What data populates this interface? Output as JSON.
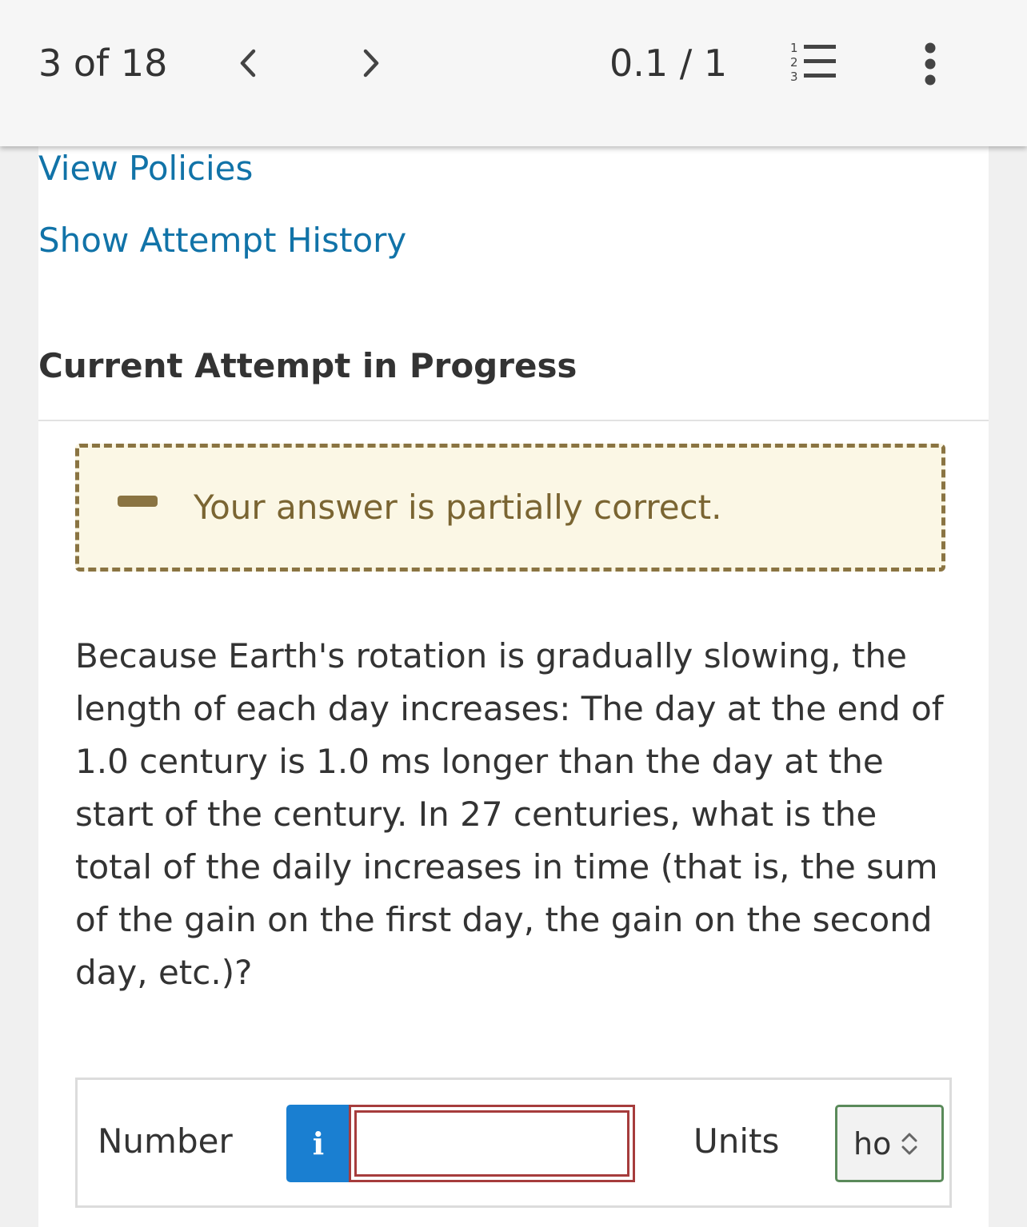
{
  "topbar": {
    "counter": "3 of 18",
    "prev_icon": "chevron-left-icon",
    "next_icon": "chevron-right-icon",
    "score": "0.1 / 1",
    "list_icon": "numbered-list-icon",
    "more_icon": "more-vertical-icon"
  },
  "links": {
    "view_policies": "View Policies",
    "show_attempt_history": "Show Attempt History"
  },
  "heading": "Current Attempt in Progress",
  "feedback": {
    "icon": "minus-icon",
    "message": "Your answer is partially correct.",
    "colors": {
      "background": "#fbf7e5",
      "border": "#8a7442",
      "text": "#7a6532"
    }
  },
  "question": "Because Earth's rotation is gradually slowing, the length of each day increases: The day at the end of 1.0 century is 1.0 ms longer than the day at the start of the century. In 27 centuries, what is the total of the daily increases in time (that is, the sum of the gain on the first day, the gain on the second day, etc.)?",
  "answer": {
    "number_label": "Number",
    "info_button": "i",
    "number_value": "",
    "units_label": "Units",
    "units_value": "ho",
    "units_icon": "select-updown-icon",
    "colors": {
      "info": "#1a7fd1",
      "input_error_border": "#a63c3c",
      "units_border": "#5a8a5a"
    }
  },
  "colors": {
    "link": "#1173a8",
    "text": "#333333"
  }
}
